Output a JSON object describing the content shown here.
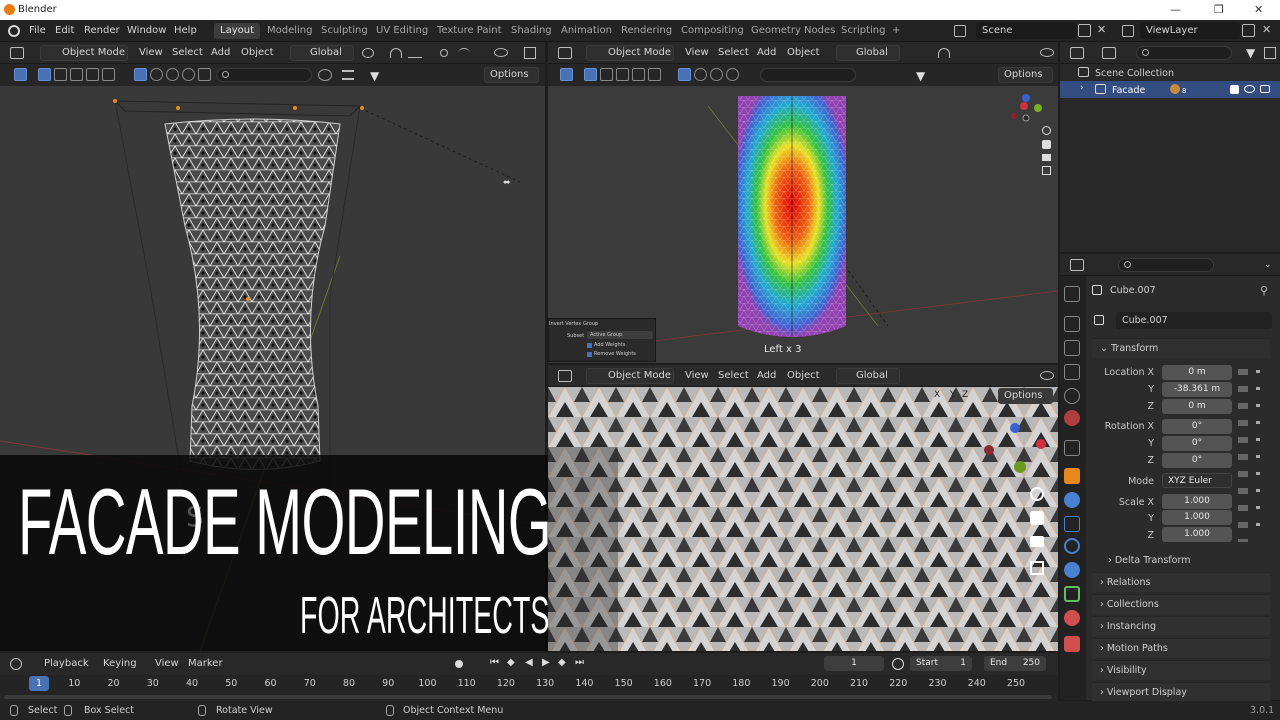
{
  "window": {
    "title": "Blender",
    "minimize": "—",
    "maximize": "❐",
    "close": "✕"
  },
  "menu": {
    "items": [
      "File",
      "Edit",
      "Render",
      "Window",
      "Help"
    ]
  },
  "workspaces": [
    "Layout",
    "Modeling",
    "Sculpting",
    "UV Editing",
    "Texture Paint",
    "Shading",
    "Animation",
    "Rendering",
    "Compositing",
    "Geometry Nodes",
    "Scripting"
  ],
  "workspace_add": "+",
  "scene": {
    "label": "Scene",
    "view_layer": "ViewLayer"
  },
  "viewport_header": {
    "mode": "Object Mode",
    "menus": [
      "View",
      "Select",
      "Add",
      "Object"
    ],
    "orientation": "Global",
    "options": "Options"
  },
  "viewport_right_top": {
    "overlay_title": "Invert Vertex Group",
    "subset_label": "Subset",
    "subset_value": "Active Group",
    "add_weights": "Add Weights",
    "remove_weights": "Remove Weights",
    "view_label": "Left x 3"
  },
  "viewport_right_bottom": {
    "axes": [
      "X",
      "Y",
      "Z"
    ]
  },
  "overlay": {
    "title": "FACADE MODELING",
    "subtitle": "FOR ARCHITECTS",
    "ghost_letter": "S"
  },
  "outliner": {
    "collection": "Scene Collection",
    "object": "Facade",
    "badge": "8"
  },
  "properties": {
    "object_name": "Cube.007",
    "data_name": "Cube.007",
    "transform_label": "Transform",
    "location": {
      "label": "Location X",
      "x": "0 m",
      "y": "-38.361 m",
      "z": "0 m"
    },
    "rotation": {
      "label": "Rotation X",
      "x": "0°",
      "y": "0°",
      "z": "0°"
    },
    "mode": {
      "label": "Mode",
      "value": "XYZ Euler"
    },
    "scale": {
      "label": "Scale X",
      "x": "1.000",
      "y": "1.000",
      "z": "1.000"
    },
    "axis_y": "Y",
    "axis_z": "Z",
    "delta_transform": "Delta Transform",
    "sections": [
      "Relations",
      "Collections",
      "Instancing",
      "Motion Paths",
      "Visibility",
      "Viewport Display"
    ]
  },
  "timeline": {
    "menus": [
      "Playback",
      "Keying",
      "View",
      "Marker"
    ],
    "current_frame": "1",
    "start_label": "Start",
    "start": "1",
    "end_label": "End",
    "end": "250",
    "ticks": [
      "1",
      "10",
      "20",
      "30",
      "40",
      "50",
      "60",
      "70",
      "80",
      "90",
      "100",
      "110",
      "120",
      "130",
      "140",
      "150",
      "160",
      "170",
      "180",
      "190",
      "200",
      "210",
      "220",
      "230",
      "240",
      "250"
    ]
  },
  "statusbar": {
    "select": "Select",
    "box_select": "Box Select",
    "rotate_view": "Rotate View",
    "context_menu": "Object Context Menu",
    "version": "3.0.1"
  },
  "colors": {
    "accent": "#4772b3",
    "active_object": "#e8891d",
    "background": "#1d1d1d"
  }
}
